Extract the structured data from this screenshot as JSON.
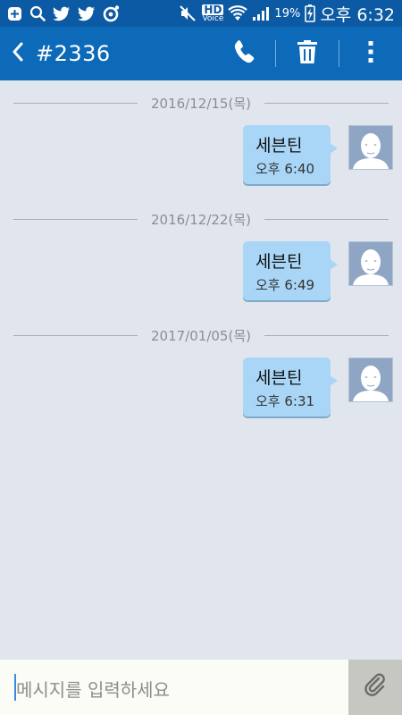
{
  "status_bar": {
    "battery_percent": "19%",
    "time": "오후 6:32",
    "hd_label": "HD",
    "voice_label": "Voice",
    "icons": [
      "plus-box-icon",
      "search-icon",
      "twitter-icon",
      "twitter-icon",
      "swirl-icon",
      "mute-icon",
      "hd-voice-icon",
      "wifi-icon",
      "signal-icon",
      "battery-charging-icon"
    ]
  },
  "header": {
    "title": "#2336",
    "back_icon": "chevron-left-icon",
    "call_icon": "phone-icon",
    "delete_icon": "trash-icon",
    "menu_icon": "more-vert-icon"
  },
  "messages": [
    {
      "date": "2016/12/15(목)",
      "text": "세븐틴",
      "time": "오후 6:40"
    },
    {
      "date": "2016/12/22(목)",
      "text": "세븐틴",
      "time": "오후 6:49"
    },
    {
      "date": "2017/01/05(목)",
      "text": "세븐틴",
      "time": "오후 6:31"
    }
  ],
  "composer": {
    "placeholder": "메시지를 입력하세요",
    "attach_icon": "paperclip-icon"
  },
  "colors": {
    "status_bar_bg": "#0c5aa3",
    "action_bar_bg": "#0c6ab8",
    "screen_bg": "#e1e6ee",
    "bubble_bg": "#a9d6f7",
    "input_bg": "#fbfcf5",
    "attach_bg": "#c7c7c2"
  }
}
